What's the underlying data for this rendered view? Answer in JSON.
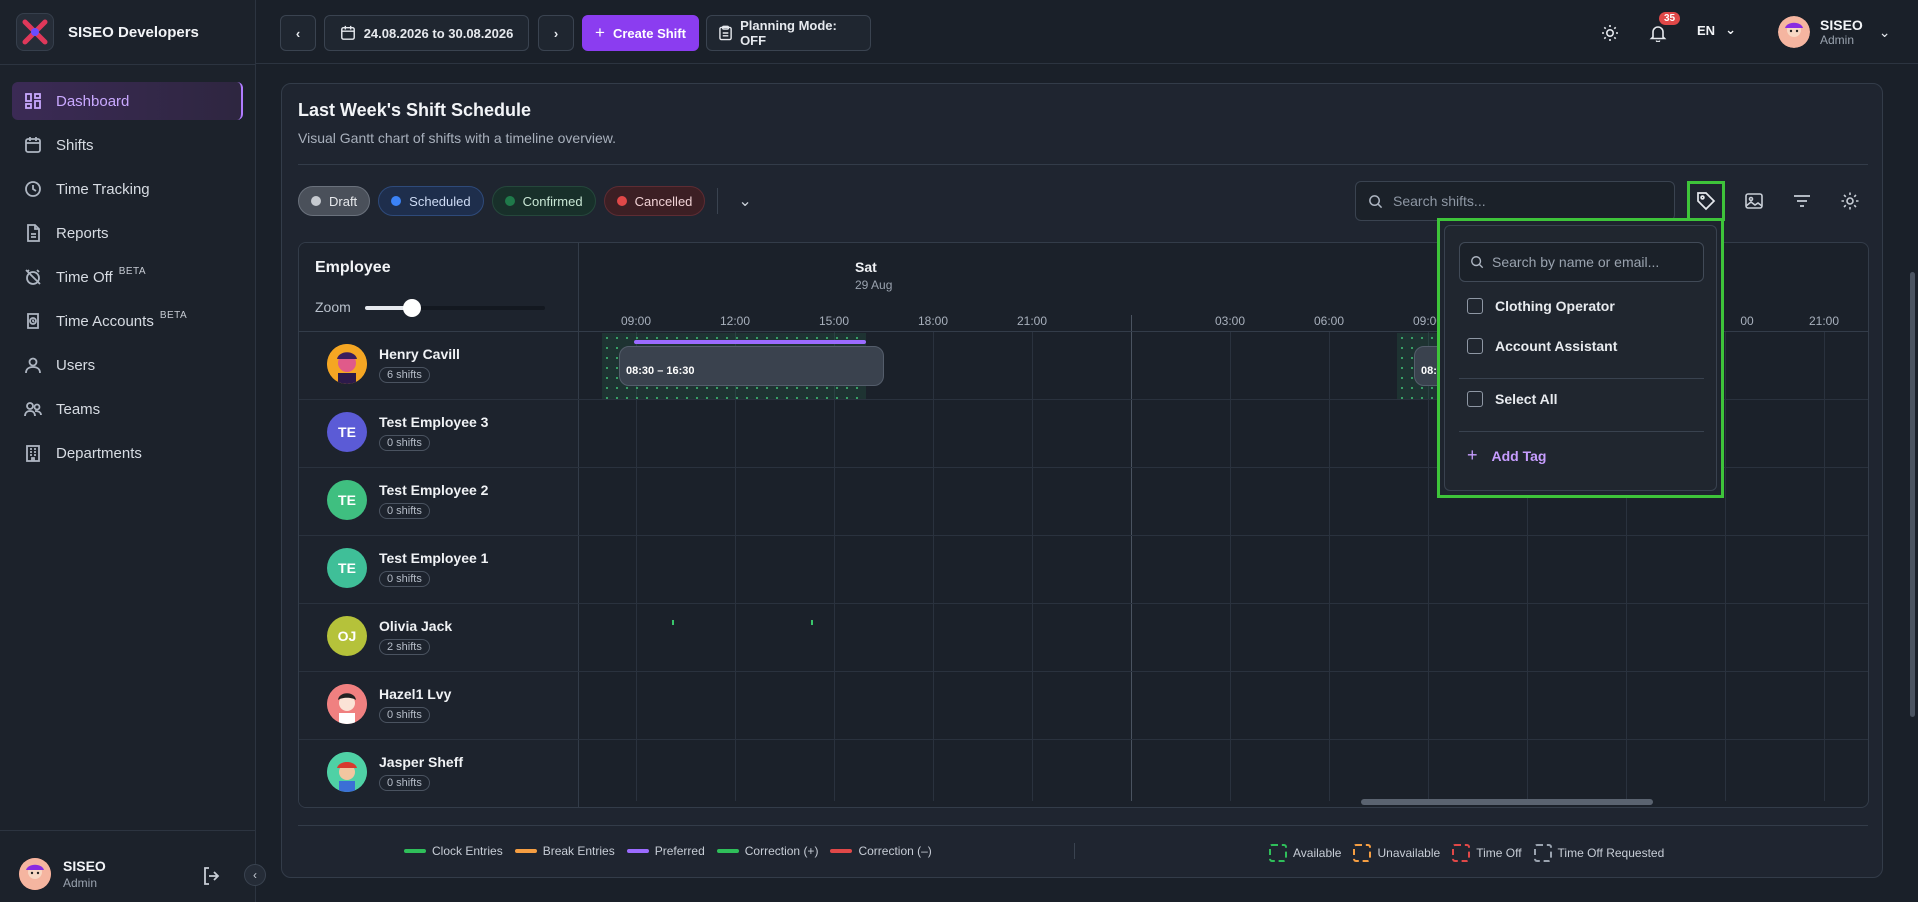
{
  "brand": {
    "name": "SISEO Developers"
  },
  "sidebar": {
    "items": [
      {
        "label": "Dashboard",
        "icon": "dashboard-icon",
        "active": true
      },
      {
        "label": "Shifts",
        "icon": "calendar-icon"
      },
      {
        "label": "Time Tracking",
        "icon": "clock-icon"
      },
      {
        "label": "Reports",
        "icon": "report-icon"
      },
      {
        "label": "Time Off",
        "icon": "alarm-off-icon",
        "badge": "BETA"
      },
      {
        "label": "Time Accounts",
        "icon": "time-account-icon",
        "badge": "BETA"
      },
      {
        "label": "Users",
        "icon": "user-icon"
      },
      {
        "label": "Teams",
        "icon": "teams-icon"
      },
      {
        "label": "Departments",
        "icon": "building-icon"
      }
    ],
    "footer": {
      "name": "SISEO",
      "role": "Admin"
    }
  },
  "topbar": {
    "date_range": "24.08.2026 to 30.08.2026",
    "create_label": "Create Shift",
    "planning_label": "Planning Mode: OFF",
    "notifications_count": "35",
    "language": "EN",
    "user": {
      "name": "SISEO",
      "role": "Admin"
    }
  },
  "card": {
    "title": "Last Week's Shift Schedule",
    "subtitle": "Visual Gantt chart of shifts with a timeline overview.",
    "status_filters": [
      {
        "label": "Draft",
        "color": "#9aa0a8"
      },
      {
        "label": "Scheduled",
        "color": "#3b82f6"
      },
      {
        "label": "Confirmed",
        "color": "#1f7a4a"
      },
      {
        "label": "Cancelled",
        "color": "#e04848"
      }
    ],
    "search_placeholder": "Search shifts..."
  },
  "gantt": {
    "employee_header": "Employee",
    "zoom_label": "Zoom",
    "day": {
      "name": "Sat",
      "date": "29 Aug"
    },
    "time_labels_day1": [
      "09:00",
      "12:00",
      "15:00",
      "18:00",
      "21:00"
    ],
    "time_labels_day2": [
      "03:00",
      "06:00",
      "09:00",
      "",
      "21:00"
    ],
    "partial_labels": {
      "day2_1800_fragment": "00"
    },
    "employees": [
      {
        "name": "Henry Cavill",
        "shifts": "6 shifts",
        "initials": "",
        "color": "#f5a623"
      },
      {
        "name": "Test Employee 3",
        "shifts": "0 shifts",
        "initials": "TE",
        "color": "#5b5bd6"
      },
      {
        "name": "Test Employee 2",
        "shifts": "0 shifts",
        "initials": "TE",
        "color": "#3fbf80"
      },
      {
        "name": "Test Employee 1",
        "shifts": "0 shifts",
        "initials": "TE",
        "color": "#3fbf98"
      },
      {
        "name": "Olivia Jack",
        "shifts": "2 shifts",
        "initials": "OJ",
        "color": "#b5c23a"
      },
      {
        "name": "Hazel1 Lvy",
        "shifts": "0 shifts",
        "initials": "",
        "color": "#f08080"
      },
      {
        "name": "Jasper Sheff",
        "shifts": "0 shifts",
        "initials": "",
        "color": "#4fd1a5"
      }
    ],
    "shift_label": "08:30 – 16:30",
    "shift_label_partial": "08:3"
  },
  "legend": {
    "entries": [
      {
        "label": "Clock Entries",
        "color": "#2fbf5a"
      },
      {
        "label": "Break Entries",
        "color": "#f59e42"
      },
      {
        "label": "Preferred",
        "color": "#9b6bff"
      },
      {
        "label": "Correction (+)",
        "color": "#2fbf5a"
      },
      {
        "label": "Correction (–)",
        "color": "#e04848"
      }
    ],
    "boxes": [
      {
        "label": "Available",
        "color": "#2fbf5a"
      },
      {
        "label": "Unavailable",
        "color": "#f59e42"
      },
      {
        "label": "Time Off",
        "color": "#e04848"
      },
      {
        "label": "Time Off Requested",
        "color": "#9aa3af"
      }
    ]
  },
  "tag_dropdown": {
    "search_placeholder": "Search by name or email...",
    "options": [
      "Clothing Operator",
      "Account Assistant"
    ],
    "select_all": "Select All",
    "add_tag": "Add Tag"
  }
}
